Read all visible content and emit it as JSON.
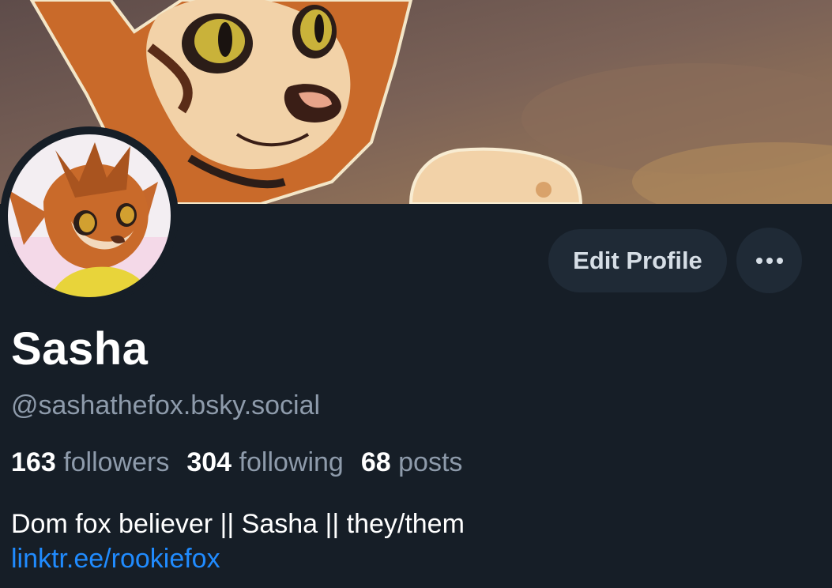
{
  "profile": {
    "display_name": "Sasha",
    "handle": "@sashathefox.bsky.social",
    "bio": "Dom fox believer || Sasha || they/them",
    "link": "linktr.ee/rookiefox"
  },
  "stats": {
    "followers_count": "163",
    "followers_label": "followers",
    "following_count": "304",
    "following_label": "following",
    "posts_count": "68",
    "posts_label": "posts"
  },
  "actions": {
    "edit_label": "Edit Profile",
    "more_icon": "more-horizontal-icon"
  },
  "colors": {
    "background": "#161e27",
    "button_bg": "#1f2a36",
    "link": "#208bfe",
    "muted_text": "#8e9bab"
  }
}
